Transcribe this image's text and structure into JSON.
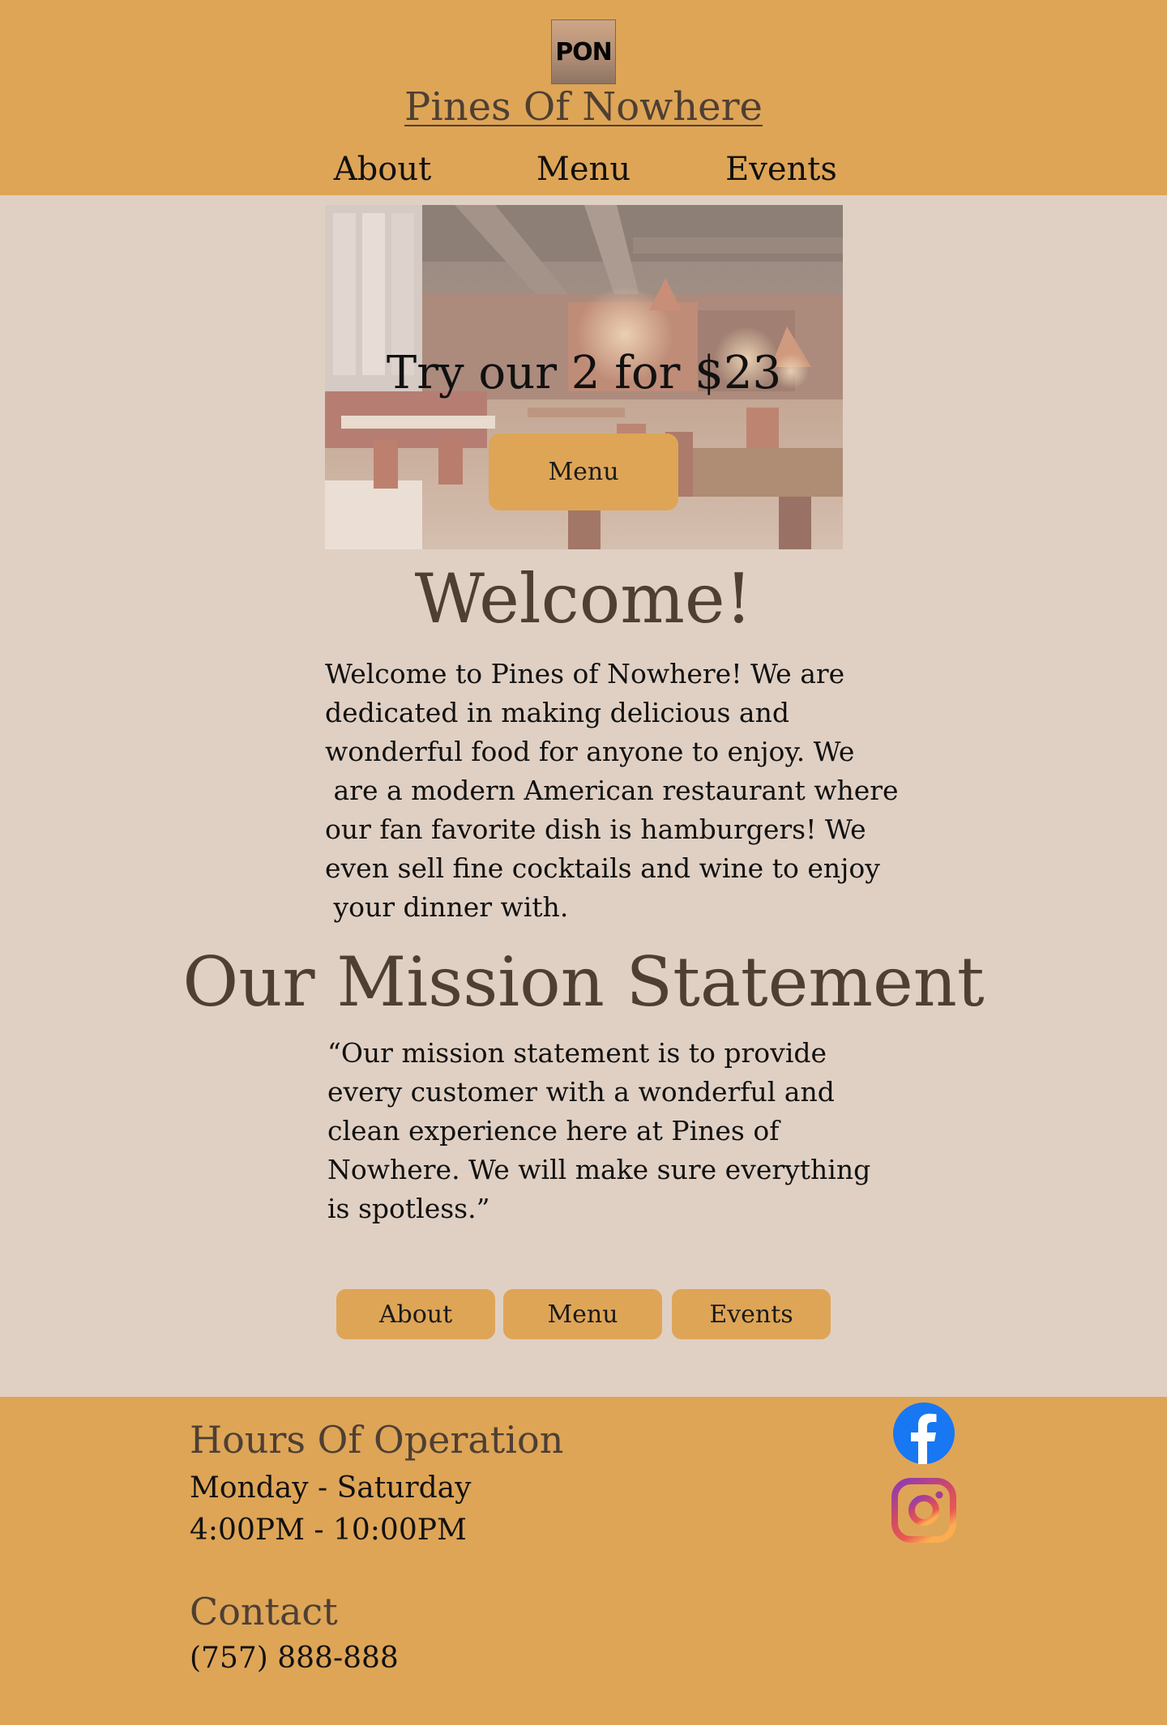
{
  "header": {
    "logo_text": "PON",
    "site_title": "Pines Of Nowhere",
    "nav": {
      "about": "About",
      "menu": "Menu",
      "events": "Events"
    }
  },
  "hero": {
    "headline": "Try our 2 for $23",
    "button_label": "Menu"
  },
  "welcome": {
    "heading": "Welcome!",
    "lines": [
      "Welcome to Pines of Nowhere! We are",
      "dedicated in making delicious and",
      "wonderful food for anyone to enjoy. We",
      " are a modern American restaurant where",
      "our fan favorite dish is hamburgers! We",
      "even sell fine cocktails and wine to enjoy",
      " your dinner with."
    ]
  },
  "mission": {
    "heading": "Our Mission Statement",
    "lines": [
      "“Our mission statement is to provide",
      "every customer with a wonderful and",
      "clean experience here at Pines of",
      "Nowhere. We will make sure everything",
      "is spotless.”"
    ]
  },
  "bottom_nav": {
    "about": "About",
    "menu": "Menu",
    "events": "Events"
  },
  "footer": {
    "hours_heading": "Hours Of Operation",
    "hours_days": "Monday - Saturday",
    "hours_time": "4:00PM - 10:00PM",
    "contact_heading": "Contact",
    "phone": "(757) 888-888",
    "social_icons": [
      "facebook-icon",
      "instagram-icon"
    ]
  },
  "colors": {
    "header_footer_bg": "#dea557",
    "page_bg": "#e0d0c3",
    "heading_text": "#4e3f33",
    "body_text": "#111111",
    "facebook_blue": "#1877f2"
  }
}
